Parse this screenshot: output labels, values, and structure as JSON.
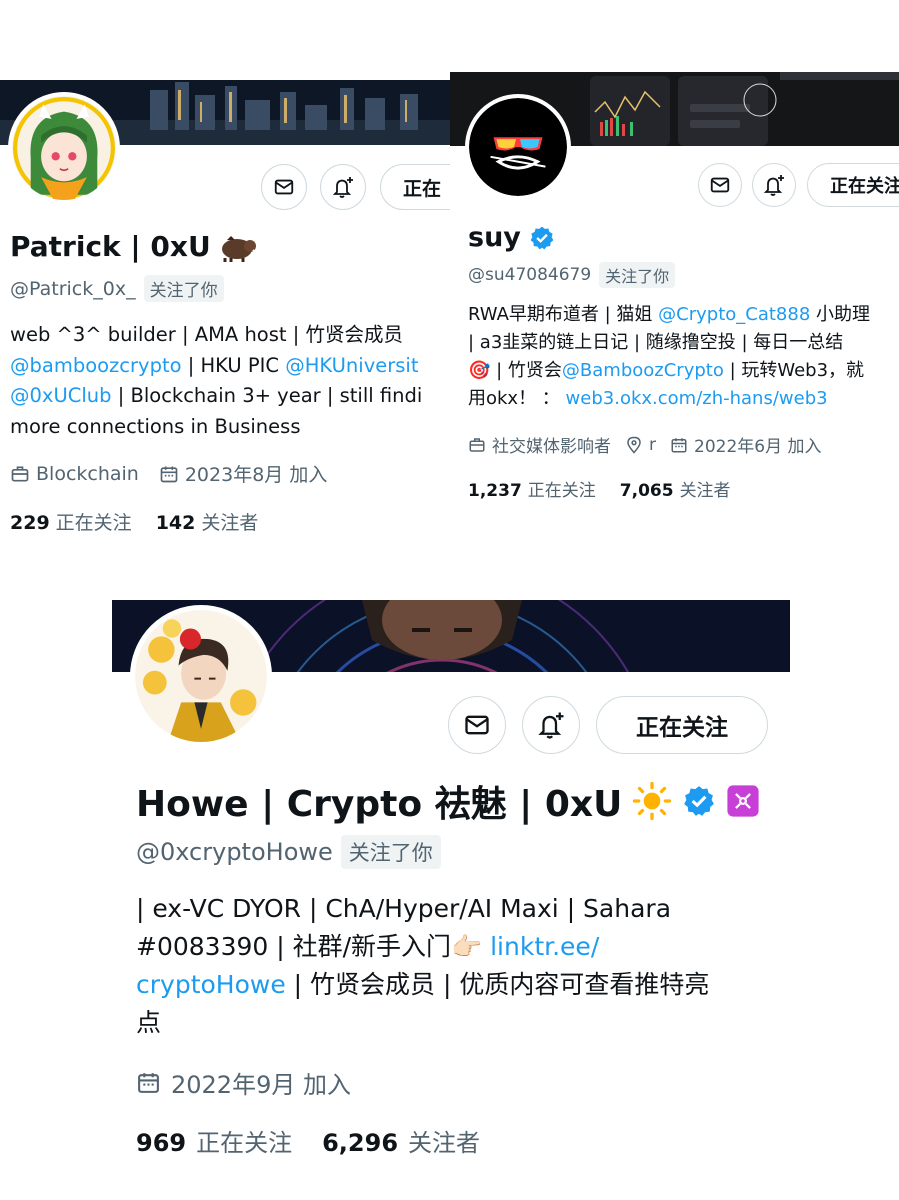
{
  "profiles": [
    {
      "name": "Patrick | 0xU",
      "name_emoji": "boar",
      "handle": "@Patrick_0x_",
      "follows_you": "关注了你",
      "follow_button": "正在",
      "bio_lines": [
        [
          {
            "t": "web ^3^ builder | AMA host | 竹贤会成员"
          }
        ],
        [
          {
            "t": "@bamboozcrypto",
            "link": true
          },
          {
            "t": " | HKU PIC "
          },
          {
            "t": "@HKUniversit",
            "link": true
          }
        ],
        [
          {
            "t": "@0xUClub",
            "link": true
          },
          {
            "t": " | Blockchain 3+ year | still findi"
          }
        ],
        [
          {
            "t": "more connections in Business"
          }
        ]
      ],
      "category": "Blockchain",
      "joined": "2023年8月 加入",
      "following_count": "229",
      "following_label": "正在关注",
      "followers_count": "142",
      "followers_label": "关注者"
    },
    {
      "name": "suy",
      "verified": true,
      "handle": "@su47084679",
      "follows_you": "关注了你",
      "follow_button": "正在关注",
      "bio_lines": [
        [
          {
            "t": "RWA早期布道者 | 猫姐 "
          },
          {
            "t": "@Crypto_Cat888",
            "link": true
          },
          {
            "t": " 小助理"
          }
        ],
        [
          {
            "t": "| a3韭菜的链上日记 | 随缘撸空投 | 每日一总结"
          }
        ],
        [
          {
            "t": "🎯 | 竹贤会"
          },
          {
            "t": "@BamboozCrypto",
            "link": true
          },
          {
            "t": " | 玩转Web3，就"
          }
        ],
        [
          {
            "t": "用okx！ ： "
          },
          {
            "t": "web3.okx.com/zh-hans/web3",
            "link": true
          }
        ]
      ],
      "category": "社交媒体影响者",
      "location": "r",
      "joined": "2022年6月 加入",
      "following_count": "1,237",
      "following_label": "正在关注",
      "followers_count": "7,065",
      "followers_label": "关注者"
    },
    {
      "name": "Howe | Crypto 祛魅 | 0xU",
      "verified": true,
      "handle": "@0xcryptoHowe",
      "follows_you": "关注了你",
      "follow_button": "正在关注",
      "bio_lines": [
        [
          {
            "t": "| ex-VC DYOR | ChA/Hyper/AI Maxi | Sahara"
          }
        ],
        [
          {
            "t": "#0083390 | 社群/新手入门👉🏻 "
          },
          {
            "t": "linktr.ee/",
            "link": true
          }
        ],
        [
          {
            "t": "cryptoHowe",
            "link": true
          },
          {
            "t": " | 竹贤会成员 | 优质内容可查看推特亮"
          }
        ],
        [
          {
            "t": "点"
          }
        ]
      ],
      "joined": "2022年9月 加入",
      "following_count": "969",
      "following_label": "正在关注",
      "followers_count": "6,296",
      "followers_label": "关注者"
    }
  ],
  "colors": {
    "link": "#1d9bf0",
    "secondary": "#536471",
    "primary": "#0f1419",
    "verified": "#1d9bf0",
    "border": "#cfd9de"
  },
  "icons": [
    "mail-icon",
    "bell-plus-icon",
    "verified-badge-icon",
    "briefcase-icon",
    "calendar-icon",
    "location-pin-icon",
    "sun-icon",
    "sahara-logo-icon",
    "boar-icon"
  ]
}
